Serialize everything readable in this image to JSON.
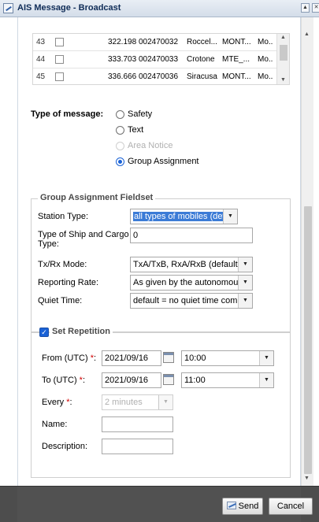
{
  "window": {
    "title": "AIS Message - Broadcast"
  },
  "grid": {
    "rows": [
      {
        "num": "43",
        "value": "322.198",
        "mmsi": "002470032",
        "name": "Roccel...",
        "callsign": "MONT...",
        "type": "Mo.."
      },
      {
        "num": "44",
        "value": "333.703",
        "mmsi": "002470033",
        "name": "Crotone",
        "callsign": "MTE_...",
        "type": "Mo.."
      },
      {
        "num": "45",
        "value": "336.666",
        "mmsi": "002470036",
        "name": "Siracusa",
        "callsign": "MONT...",
        "type": "Mo.."
      }
    ]
  },
  "type_of_message": {
    "label": "Type of message:",
    "options": [
      {
        "label": "Safety",
        "selected": false,
        "disabled": false
      },
      {
        "label": "Text",
        "selected": false,
        "disabled": false
      },
      {
        "label": "Area Notice",
        "selected": false,
        "disabled": true
      },
      {
        "label": "Group Assignment",
        "selected": true,
        "disabled": false
      }
    ]
  },
  "group_assignment": {
    "legend": "Group Assignment Fieldset",
    "station_type": {
      "label": "Station Type:",
      "value": "all types of mobiles (default)"
    },
    "ship_cargo_type": {
      "label": "Type of Ship and Cargo Type:",
      "value": "0"
    },
    "txrx_mode": {
      "label": "Tx/Rx Mode:",
      "value": "TxA/TxB, RxA/RxB (default)"
    },
    "reporting_rate": {
      "label": "Reporting Rate:",
      "value": "As given by the autonomous m"
    },
    "quiet_time": {
      "label": "Quiet Time:",
      "value": "default = no quiet time comma"
    }
  },
  "repetition": {
    "legend": "Set Repetition",
    "checked": true,
    "from": {
      "label": "From (UTC)",
      "date": "2021/09/16",
      "time": "10:00"
    },
    "to": {
      "label": "To (UTC)",
      "date": "2021/09/16",
      "time": "11:00"
    },
    "every": {
      "label": "Every",
      "value": "2 minutes"
    },
    "name": {
      "label": "Name:",
      "value": ""
    },
    "description": {
      "label": "Description:",
      "value": ""
    },
    "required_mark": "*",
    "colon": ":"
  },
  "footer": {
    "send_label": "Send",
    "cancel_label": "Cancel"
  },
  "colors": {
    "accent": "#1a62d6",
    "footer_bg": "#515151"
  }
}
